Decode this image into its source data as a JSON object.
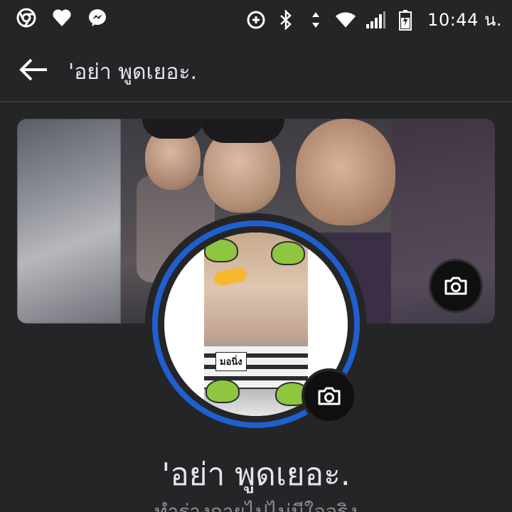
{
  "status_bar": {
    "time": "10:44 น.",
    "left_icons": [
      "chrome-icon",
      "heart-icon",
      "messenger-icon"
    ],
    "right_icons": [
      "data-saver-icon",
      "bluetooth-icon",
      "wifi-icon",
      "signal-icon",
      "battery-icon"
    ]
  },
  "header": {
    "title": "'อย่า พูดเยอะ."
  },
  "cover": {
    "camera_icon": "camera-icon"
  },
  "profile": {
    "photo_sticker_label": "มอนิ่ง",
    "camera_icon": "camera-icon",
    "ring_color": "#1f5fcf"
  },
  "name": "'อย่า พูดเยอะ.",
  "subtitle": "ทำร่างกายไปไม่มีใจจริง"
}
